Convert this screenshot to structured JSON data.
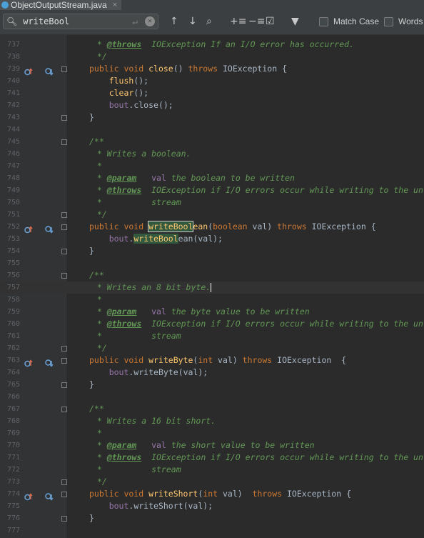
{
  "tab": {
    "title": "ObjectOutputStream.java",
    "close": "×"
  },
  "search": {
    "query": "writeBool",
    "match_case_label": "Match Case",
    "words_label": "Words"
  },
  "colors": {
    "keyword": "#cc7832",
    "comment": "#629755",
    "method": "#ffc66d",
    "highlight": "#32593d"
  },
  "lines": [
    {
      "n": "737",
      "tokens": [
        [
          "cm",
          " * "
        ],
        [
          "tag",
          "@throws"
        ],
        [
          "cm",
          "  IOException If an I/O error has occurred."
        ]
      ]
    },
    {
      "n": "738",
      "tokens": [
        [
          "cm",
          " */"
        ]
      ]
    },
    {
      "n": "739",
      "tokens": [
        [
          "kw",
          "public void "
        ],
        [
          "fn",
          "close"
        ],
        [
          "ty",
          "() "
        ],
        [
          "kw",
          "throws "
        ],
        [
          "ty",
          "IOException {"
        ]
      ],
      "gutter": true
    },
    {
      "n": "740",
      "tokens": [
        [
          "ty",
          "    "
        ],
        [
          "fn",
          "flush"
        ],
        [
          "ty",
          "();"
        ]
      ]
    },
    {
      "n": "741",
      "tokens": [
        [
          "ty",
          "    "
        ],
        [
          "fn",
          "clear"
        ],
        [
          "ty",
          "();"
        ]
      ]
    },
    {
      "n": "742",
      "tokens": [
        [
          "ty",
          "    "
        ],
        [
          "field",
          "bout"
        ],
        [
          "ty",
          ".close();"
        ]
      ]
    },
    {
      "n": "743",
      "tokens": [
        [
          "ty",
          "}"
        ]
      ]
    },
    {
      "n": "744",
      "tokens": []
    },
    {
      "n": "745",
      "tokens": [
        [
          "cm",
          "/**"
        ]
      ]
    },
    {
      "n": "746",
      "tokens": [
        [
          "cm",
          " * Writes a boolean."
        ]
      ]
    },
    {
      "n": "747",
      "tokens": [
        [
          "cm",
          " *"
        ]
      ]
    },
    {
      "n": "748",
      "tokens": [
        [
          "cm",
          " * "
        ],
        [
          "tag",
          "@param"
        ],
        [
          "cm",
          "   "
        ],
        [
          "field",
          "val"
        ],
        [
          "cm",
          " the boolean to be written"
        ]
      ]
    },
    {
      "n": "749",
      "tokens": [
        [
          "cm",
          " * "
        ],
        [
          "tag",
          "@throws"
        ],
        [
          "cm",
          "  IOException if I/O errors occur while writing to the un"
        ]
      ]
    },
    {
      "n": "750",
      "tokens": [
        [
          "cm",
          " *          stream"
        ]
      ]
    },
    {
      "n": "751",
      "tokens": [
        [
          "cm",
          " */"
        ]
      ]
    },
    {
      "n": "752",
      "tokens": [
        [
          "kw",
          "public void "
        ],
        [
          "fnhlbox",
          "writeBool"
        ],
        [
          "fn",
          "ean"
        ],
        [
          "ty",
          "("
        ],
        [
          "kw",
          "boolean "
        ],
        [
          "ty",
          "val) "
        ],
        [
          "kw",
          "throws "
        ],
        [
          "ty",
          "IOException {"
        ]
      ],
      "gutter": true
    },
    {
      "n": "753",
      "tokens": [
        [
          "ty",
          "    "
        ],
        [
          "field",
          "bout"
        ],
        [
          "ty",
          "."
        ],
        [
          "hl",
          "writeBool"
        ],
        [
          "ty",
          "ean(val);"
        ]
      ]
    },
    {
      "n": "754",
      "tokens": [
        [
          "ty",
          "}"
        ]
      ]
    },
    {
      "n": "755",
      "tokens": []
    },
    {
      "n": "756",
      "tokens": [
        [
          "cm",
          "/**"
        ]
      ]
    },
    {
      "n": "757",
      "tokens": [
        [
          "cm",
          " * Writes an 8 bit byte."
        ]
      ],
      "current": true
    },
    {
      "n": "758",
      "tokens": [
        [
          "cm",
          " *"
        ]
      ]
    },
    {
      "n": "759",
      "tokens": [
        [
          "cm",
          " * "
        ],
        [
          "tag",
          "@param"
        ],
        [
          "cm",
          "   "
        ],
        [
          "field",
          "val"
        ],
        [
          "cm",
          " the byte value to be written"
        ]
      ]
    },
    {
      "n": "760",
      "tokens": [
        [
          "cm",
          " * "
        ],
        [
          "tag",
          "@throws"
        ],
        [
          "cm",
          "  IOException if I/O errors occur while writing to the un"
        ]
      ]
    },
    {
      "n": "761",
      "tokens": [
        [
          "cm",
          " *          stream"
        ]
      ]
    },
    {
      "n": "762",
      "tokens": [
        [
          "cm",
          " */"
        ]
      ]
    },
    {
      "n": "763",
      "tokens": [
        [
          "kw",
          "public void "
        ],
        [
          "fn",
          "writeByte"
        ],
        [
          "ty",
          "("
        ],
        [
          "kw",
          "int "
        ],
        [
          "ty",
          "val) "
        ],
        [
          "kw",
          "throws "
        ],
        [
          "ty",
          "IOException  {"
        ]
      ],
      "gutter": true
    },
    {
      "n": "764",
      "tokens": [
        [
          "ty",
          "    "
        ],
        [
          "field",
          "bout"
        ],
        [
          "ty",
          ".writeByte(val);"
        ]
      ]
    },
    {
      "n": "765",
      "tokens": [
        [
          "ty",
          "}"
        ]
      ]
    },
    {
      "n": "766",
      "tokens": []
    },
    {
      "n": "767",
      "tokens": [
        [
          "cm",
          "/**"
        ]
      ]
    },
    {
      "n": "768",
      "tokens": [
        [
          "cm",
          " * Writes a 16 bit short."
        ]
      ]
    },
    {
      "n": "769",
      "tokens": [
        [
          "cm",
          " *"
        ]
      ]
    },
    {
      "n": "770",
      "tokens": [
        [
          "cm",
          " * "
        ],
        [
          "tag",
          "@param"
        ],
        [
          "cm",
          "   "
        ],
        [
          "field",
          "val"
        ],
        [
          "cm",
          " the short value to be written"
        ]
      ]
    },
    {
      "n": "771",
      "tokens": [
        [
          "cm",
          " * "
        ],
        [
          "tag",
          "@throws"
        ],
        [
          "cm",
          "  IOException if I/O errors occur while writing to the un"
        ]
      ]
    },
    {
      "n": "772",
      "tokens": [
        [
          "cm",
          " *          stream"
        ]
      ]
    },
    {
      "n": "773",
      "tokens": [
        [
          "cm",
          " */"
        ]
      ]
    },
    {
      "n": "774",
      "tokens": [
        [
          "kw",
          "public void "
        ],
        [
          "fn",
          "writeShort"
        ],
        [
          "ty",
          "("
        ],
        [
          "kw",
          "int "
        ],
        [
          "ty",
          "val)  "
        ],
        [
          "kw",
          "throws "
        ],
        [
          "ty",
          "IOException {"
        ]
      ],
      "gutter": true
    },
    {
      "n": "775",
      "tokens": [
        [
          "ty",
          "    "
        ],
        [
          "field",
          "bout"
        ],
        [
          "ty",
          ".writeShort(val);"
        ]
      ]
    },
    {
      "n": "776",
      "tokens": [
        [
          "ty",
          "}"
        ]
      ]
    },
    {
      "n": "777",
      "tokens": []
    }
  ]
}
